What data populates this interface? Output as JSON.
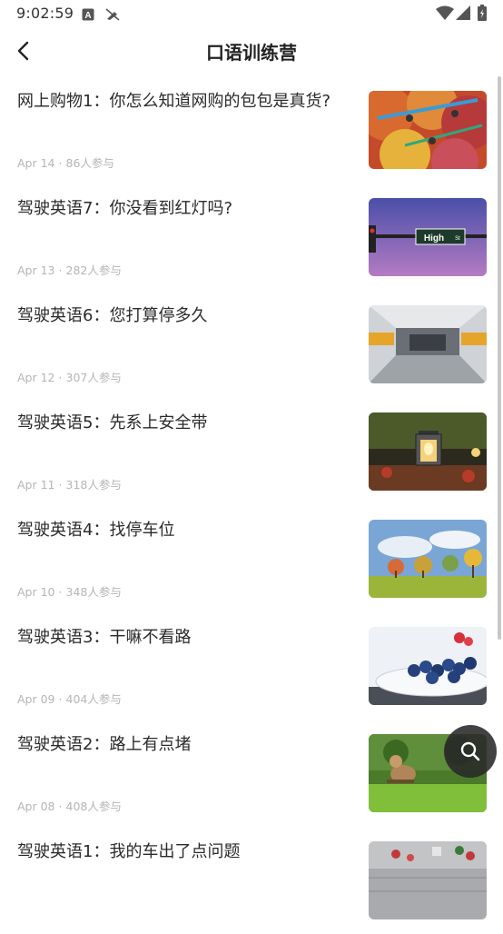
{
  "status_bar": {
    "time": "9:02:59",
    "icons": [
      "a-box-icon",
      "no-signal-pen-icon",
      "wifi-icon",
      "cellular-icon",
      "battery-icon"
    ]
  },
  "header": {
    "title": "口语训练营",
    "back_icon": "chevron-left-icon"
  },
  "items": [
    {
      "title": "网上购物1：你怎么知道网购的包包是真货?",
      "date": "Apr 14",
      "sep": "·",
      "count": "86人参与",
      "thumb": "colorful-fabric-bags"
    },
    {
      "title": "驾驶英语7：你没看到红灯吗?",
      "date": "Apr 13",
      "sep": "·",
      "count": "282人参与",
      "thumb": "high-st-street-sign"
    },
    {
      "title": "驾驶英语6：您打算停多久",
      "date": "Apr 12",
      "sep": "·",
      "count": "307人参与",
      "thumb": "parking-garage"
    },
    {
      "title": "驾驶英语5：先系上安全带",
      "date": "Apr 11",
      "sep": "·",
      "count": "318人参与",
      "thumb": "lantern-candle"
    },
    {
      "title": "驾驶英语4：找停车位",
      "date": "Apr 10",
      "sep": "·",
      "count": "348人参与",
      "thumb": "autumn-trees-field"
    },
    {
      "title": "驾驶英语3：干嘛不看路",
      "date": "Apr 09",
      "sep": "·",
      "count": "404人参与",
      "thumb": "blueberries-plate"
    },
    {
      "title": "驾驶英语2：路上有点堵",
      "date": "Apr 08",
      "sep": "·",
      "count": "408人参与",
      "thumb": "toy-on-grass"
    },
    {
      "title": "驾驶英语1：我的车出了点问题",
      "date": "",
      "sep": "",
      "count": "",
      "thumb": "christmas-decor"
    }
  ],
  "fab": {
    "icon": "search-icon"
  },
  "colors": {
    "background": "#ffffff",
    "title_text": "#222222",
    "meta_text": "#b5b5b5",
    "fab": "#282828"
  }
}
